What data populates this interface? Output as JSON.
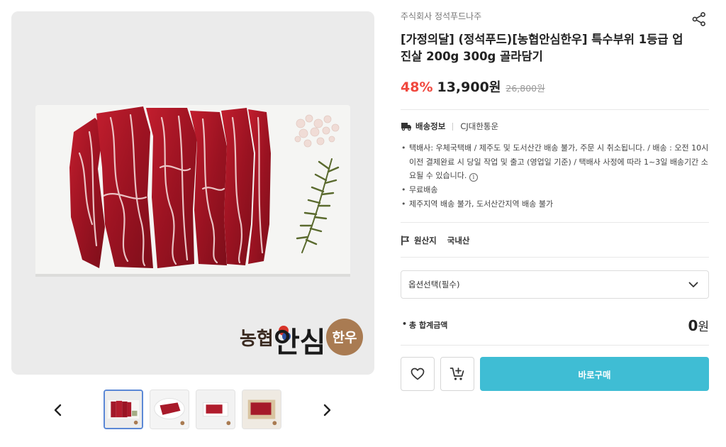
{
  "product": {
    "seller": "주식회사 정석푸드나주",
    "title": "[가정의달] (정석푸드)[농협안심한우] 특수부위 1등급 업진살 200g 300g 골라담기",
    "discount": "48%",
    "price": "13,900",
    "price_unit": "원",
    "original_price": "26,800원",
    "image_logo": {
      "prefix": "농협",
      "main": "안심",
      "badge": "한우"
    }
  },
  "shipping": {
    "label": "배송정보",
    "carrier": "CJ대한통운",
    "details": [
      "택배사: 우체국택배 / 제주도 및 도서산간 배송 불가, 주문 시 취소됩니다. / 배송 : 오전 10시 이전 결제완료 시 당일 작업 및 출고 (영업일 기준) / 택배사 사정에 따라 1~3일 배송기간 소요될 수 있습니다.",
      "무료배송",
      "제주지역 배송 불가, 도서산간지역 배송 불가"
    ],
    "info_icon": "i"
  },
  "origin": {
    "label": "원산지",
    "value": "국내산"
  },
  "option": {
    "placeholder": "옵션선택(필수)"
  },
  "total": {
    "label": "총 합계금액",
    "value": "0",
    "unit": "원"
  },
  "actions": {
    "buy_label": "바로구매"
  },
  "icons": {
    "share": "share-icon",
    "truck": "truck-icon",
    "flag": "flag-icon",
    "chevron": "chevron-down-icon",
    "heart": "heart-icon",
    "cart": "cart-plus-icon",
    "prev": "chevron-left-icon",
    "next": "chevron-right-icon"
  },
  "colors": {
    "discount": "#f0483e",
    "buy_button": "#3fbdd4",
    "thumb_active_border": "#5b88d6"
  },
  "gallery": {
    "thumbnail_count": 4,
    "active_index": 0
  }
}
